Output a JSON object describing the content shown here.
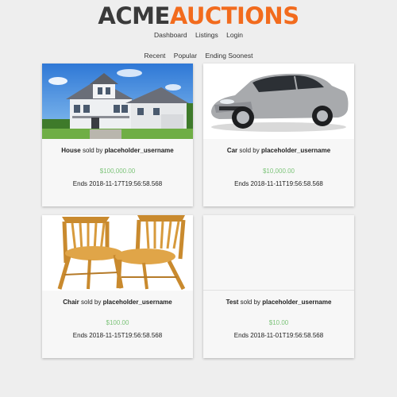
{
  "logo": {
    "part_a": "ACME",
    "part_b": "AUCTIONS"
  },
  "nav": {
    "items": [
      "Dashboard",
      "Listings",
      "Login"
    ]
  },
  "sort": {
    "items": [
      "Recent",
      "Popular",
      "Ending Soonest"
    ]
  },
  "listing": {
    "sold_by_text": "sold by",
    "items": [
      {
        "name": "House",
        "seller": "placeholder_username",
        "price": "$100,000.00",
        "ends": "Ends 2018-11-17T19:56:58.568",
        "image": "house-photo"
      },
      {
        "name": "Car",
        "seller": "placeholder_username",
        "price": "$10,000.00",
        "ends": "Ends 2018-11-11T19:56:58.568",
        "image": "car-photo"
      },
      {
        "name": "Chair",
        "seller": "placeholder_username",
        "price": "$100.00",
        "ends": "Ends 2018-11-15T19:56:58.568",
        "image": "chairs-photo"
      },
      {
        "name": "Test",
        "seller": "placeholder_username",
        "price": "$10.00",
        "ends": "Ends 2018-11-01T19:56:58.568",
        "image": ""
      }
    ]
  },
  "colors": {
    "logo_dark": "#3a3a3a",
    "logo_accent": "#f26b1d",
    "price": "#7dc47a",
    "background": "#eeeeee"
  }
}
